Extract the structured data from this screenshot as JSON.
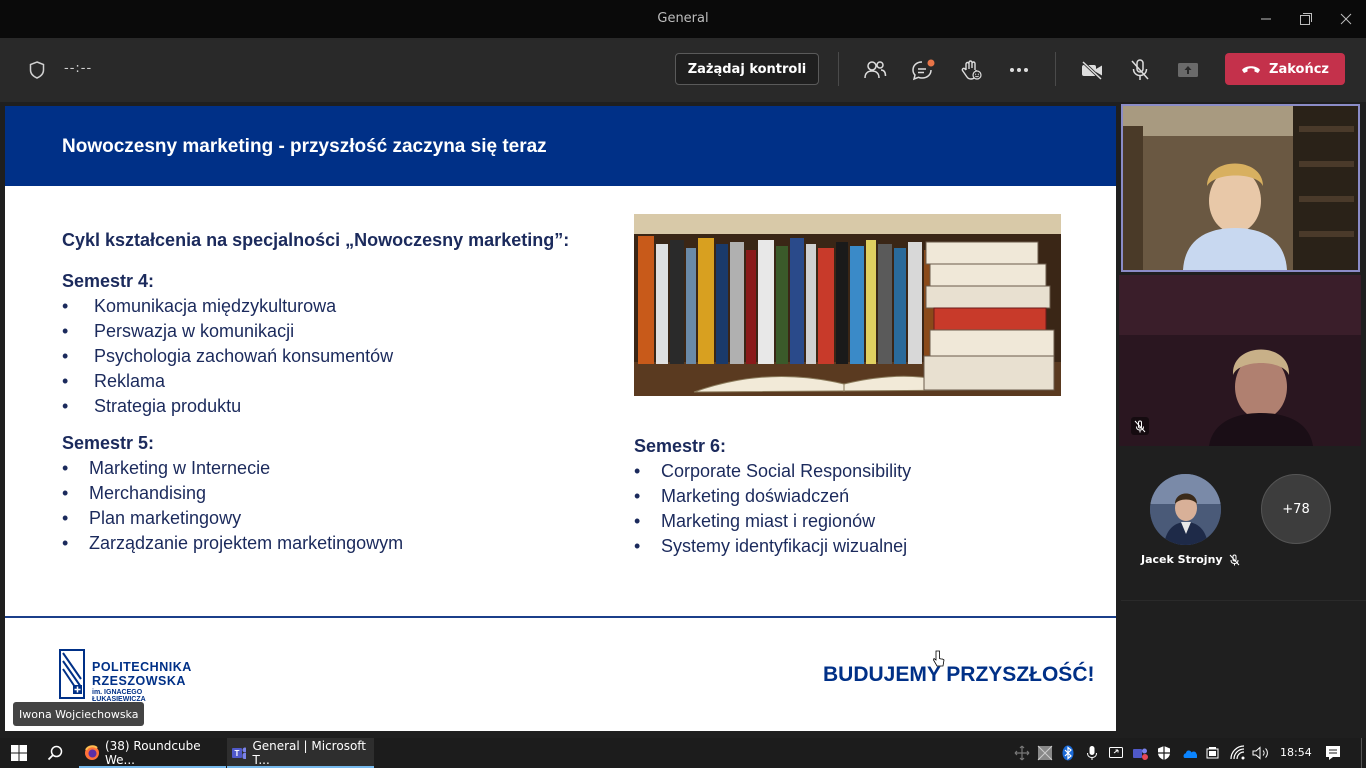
{
  "window": {
    "title": "General"
  },
  "toolbar": {
    "timer": "--:--",
    "request_control_label": "Zażądaj kontroli",
    "end_label": "Zakończ",
    "end_color": "#c4314b"
  },
  "slide": {
    "title": "Nowoczesny marketing - przyszłość zaczyna się teraz",
    "cycle_heading": "Cykl kształcenia na specjalności „Nowoczesny marketing”:",
    "semester4": {
      "heading": "Semestr 4:",
      "items": [
        "Komunikacja międzykulturowa",
        "Perswazja w komunikacji",
        "Psychologia zachowań konsumentów",
        "Reklama",
        "Strategia produktu"
      ]
    },
    "semester5": {
      "heading": "Semestr 5:",
      "items": [
        "Marketing w Internecie",
        "Merchandising",
        "Plan marketingowy",
        "Zarządzanie projektem marketingowym"
      ]
    },
    "semester6": {
      "heading": "Semestr 6:",
      "items": [
        "Corporate Social Responsibility",
        "Marketing doświadczeń",
        "Marketing miast i regionów",
        "Systemy identyfikacji wizualnej"
      ]
    },
    "bullet": "•",
    "logo": {
      "line1": "POLITECHNIKA",
      "line2": "RZESZOWSKA",
      "line3": "im. IGNACEGO ŁUKASIEWICZA"
    },
    "slogan": "BUDUJEMY PRZYSZŁOŚĆ!",
    "accent_color": "#003087"
  },
  "presenter_name": "Iwona Wojciechowska",
  "participants": {
    "avatar_name": "Jacek Strojny",
    "more_count": "+78"
  },
  "taskbar": {
    "apps": [
      {
        "label": "(38) Roundcube We...",
        "icon": "firefox-icon"
      },
      {
        "label": "General | Microsoft T...",
        "icon": "teams-icon"
      }
    ],
    "clock": "18:54"
  }
}
